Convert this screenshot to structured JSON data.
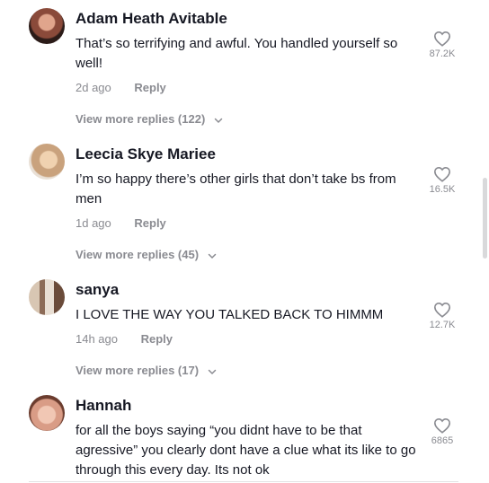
{
  "comments": [
    {
      "user": "Adam Heath Avitable",
      "text": "That’s so terrifying and awful. You handled yourself so well!",
      "time": "2d ago",
      "reply": "Reply",
      "likes": "87.2K",
      "more_replies": "View more replies (122)",
      "avatar": "avatar-adam"
    },
    {
      "user": "Leecia Skye Mariee",
      "text": "I’m so happy there’s other girls that don’t take bs from men",
      "time": "1d ago",
      "reply": "Reply",
      "likes": "16.5K",
      "more_replies": "View more replies (45)",
      "avatar": "avatar-leecia"
    },
    {
      "user": "sanya",
      "text": "I LOVE THE WAY YOU TALKED BACK TO HIMMM",
      "time": "14h ago",
      "reply": "Reply",
      "likes": "12.7K",
      "more_replies": "View more replies (17)",
      "avatar": "avatar-sanya"
    },
    {
      "user": "Hannah",
      "text": "for all the boys saying “you didnt have to be that agressive” you clearly dont have a clue what its like to go through this every day. Its not ok",
      "time": "",
      "reply": "",
      "likes": "6865",
      "more_replies": "",
      "avatar": "avatar-hannah"
    }
  ],
  "icons": {
    "like": "heart-outline-icon",
    "expand": "chevron-down-icon"
  },
  "colors": {
    "text": "#161823",
    "muted": "#8a8b91",
    "background": "#ffffff"
  }
}
